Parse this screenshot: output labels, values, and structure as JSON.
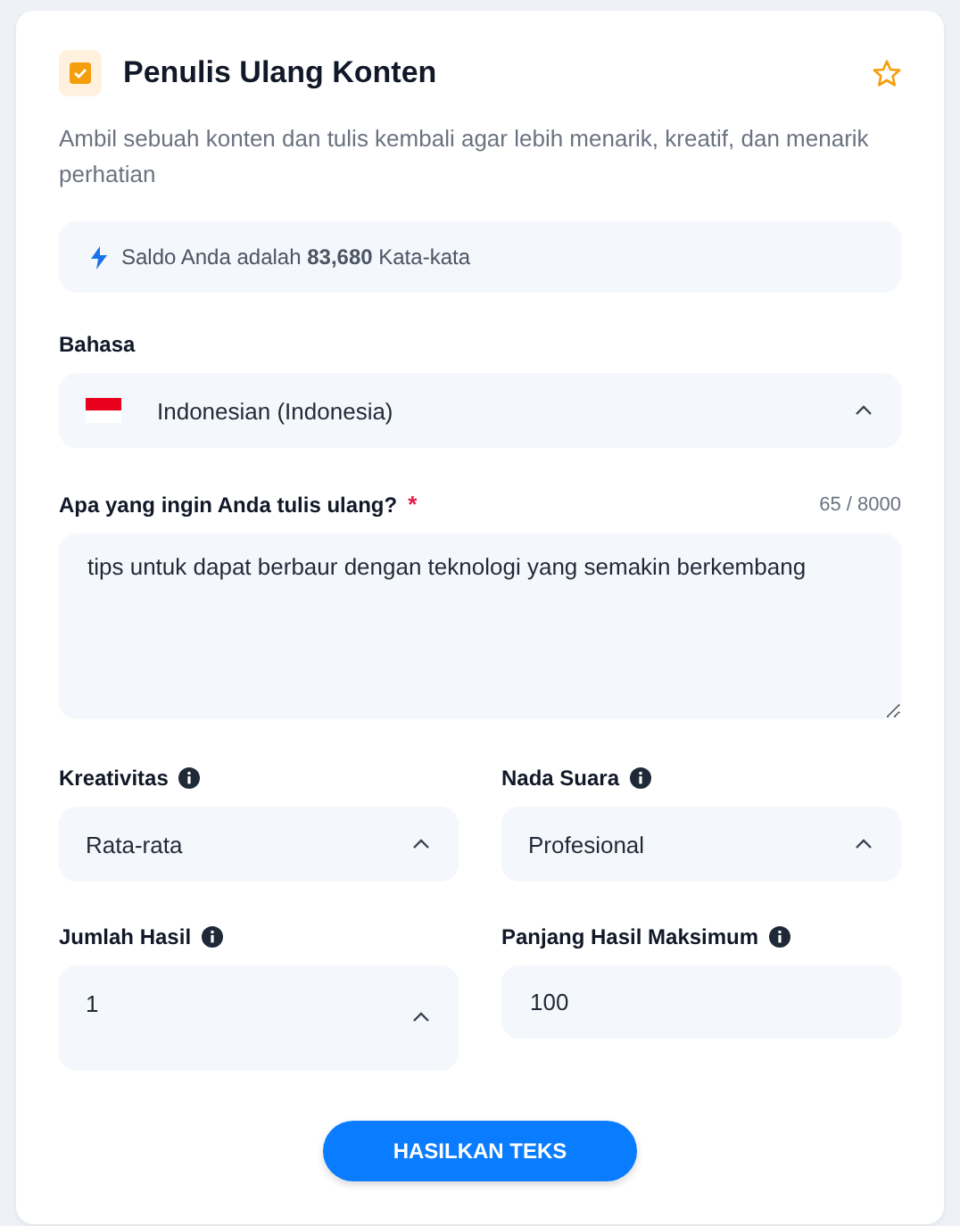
{
  "header": {
    "title": "Penulis Ulang Konten",
    "favorite": false
  },
  "description": "Ambil sebuah konten dan tulis kembali agar lebih menarik, kreatif, dan menarik perhatian",
  "balance": "Saldo Anda adalah **83,680** Kata-kata",
  "language": {
    "label": "Bahasa",
    "value": "Indonesian (Indonesia)"
  },
  "content": {
    "label": "Apa yang ingin Anda tulis ulang?",
    "required_mark": "*",
    "counter": "65 / 8000",
    "value": "tips untuk dapat berbaur dengan teknologi yang semakin berkembang"
  },
  "settings": [
    {
      "label": "Kreativitas",
      "kind": "select",
      "value": "Rata-rata"
    },
    {
      "label": "Nada Suara",
      "kind": "select",
      "value": "Profesional"
    },
    {
      "label": "Jumlah Hasil",
      "kind": "number-select",
      "value": "1"
    },
    {
      "label": "Panjang Hasil Maksimum",
      "kind": "input",
      "value": "100"
    }
  ],
  "submit": "HASILKAN TEKS"
}
